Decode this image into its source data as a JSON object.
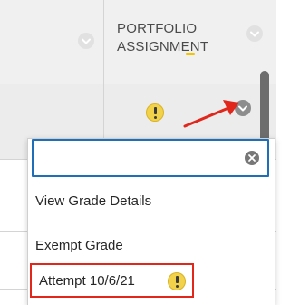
{
  "column_header": {
    "title_line1": "PORTFOLIO",
    "title_line2": "ASSIGNMENT"
  },
  "grade_cell": {
    "status_icon": "exclamation-circle-icon",
    "menu_icon": "chevron-down-icon"
  },
  "context_menu": {
    "search_value": "",
    "search_placeholder": "",
    "clear_icon": "clear-search-icon",
    "items": [
      {
        "label": "View Grade Details"
      },
      {
        "label": "Exempt Grade"
      },
      {
        "label": "Attempt 10/6/21",
        "icon": "exclamation-circle-icon",
        "highlighted": true
      }
    ]
  },
  "annotation": {
    "arrow_color": "#e1261c",
    "highlight_color": "#e1261c",
    "accent_focus_color": "#1e6fb8",
    "status_color": "#f1d24a"
  }
}
